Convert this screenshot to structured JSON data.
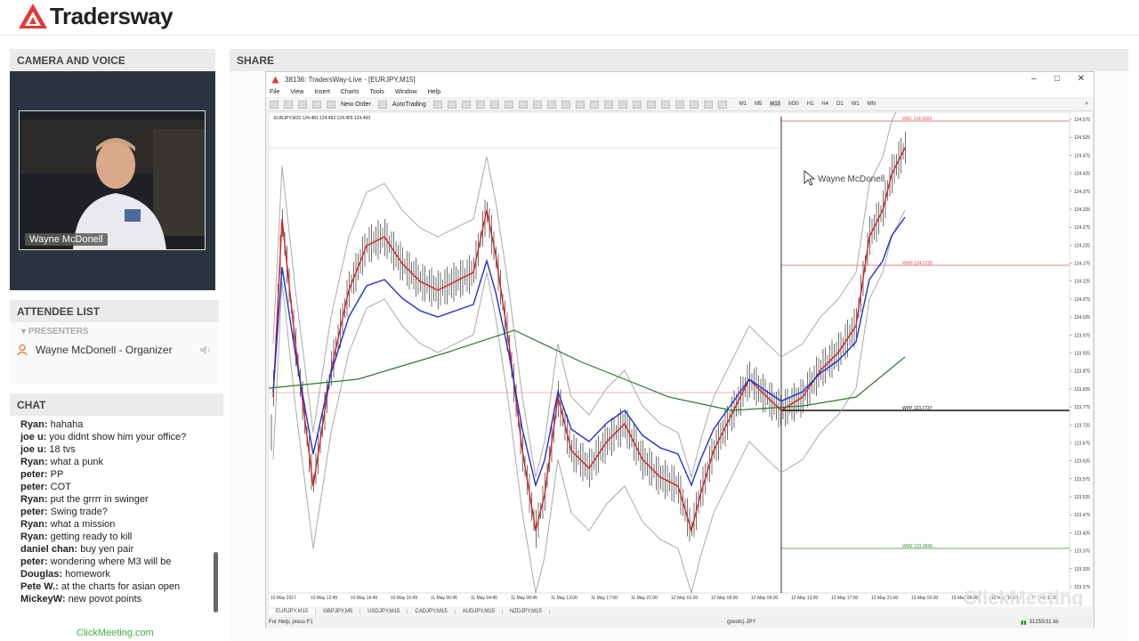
{
  "header": {
    "brand": "Tradersway"
  },
  "camera": {
    "heading": "CAMERA AND VOICE",
    "presenter_name": "Wayne McDonell"
  },
  "attendees": {
    "heading": "ATTENDEE LIST",
    "group_label": "PRESENTERS",
    "items": [
      {
        "name": "Wayne McDonell - Organizer"
      }
    ]
  },
  "chat": {
    "heading": "CHAT",
    "messages": [
      {
        "user": "Ryan:",
        "text": "hahaha"
      },
      {
        "user": "joe u:",
        "text": "you didnt show him your office?"
      },
      {
        "user": "joe u:",
        "text": "18 tvs"
      },
      {
        "user": "Ryan:",
        "text": "what a punk"
      },
      {
        "user": "peter:",
        "text": "PP"
      },
      {
        "user": "peter:",
        "text": "COT"
      },
      {
        "user": "Ryan:",
        "text": "put the grrrr in swinger"
      },
      {
        "user": "peter:",
        "text": "Swing trade?"
      },
      {
        "user": "Ryan:",
        "text": "what a mission"
      },
      {
        "user": "Ryan:",
        "text": "getting ready to kill"
      },
      {
        "user": "daniel chan:",
        "text": "buy yen pair"
      },
      {
        "user": "peter:",
        "text": "wondering where M3 will be"
      },
      {
        "user": "Douglas:",
        "text": "homework"
      },
      {
        "user": "Pete W.:",
        "text": "at the charts for asian open"
      },
      {
        "user": "MickeyW:",
        "text": "new povot points"
      }
    ]
  },
  "footer": {
    "link": "ClickMeeting.com"
  },
  "share": {
    "heading": "SHARE"
  },
  "mt4": {
    "title": "38136: TradersWay-Live - [EURJPY,M15]",
    "menu": [
      "File",
      "View",
      "Insert",
      "Charts",
      "Tools",
      "Window",
      "Help"
    ],
    "toolbar": {
      "new_order": "New Order",
      "auto_trading": "AutoTrading"
    },
    "timeframes": [
      "M1",
      "M5",
      "M15",
      "M30",
      "H1",
      "H4",
      "D1",
      "W1",
      "MN"
    ],
    "symbol_line": "EURJPY,M15  124.481 124.493 124.455 124.493",
    "pivot_labels": [
      "WR1 124.5693",
      "WM3 124.1735",
      "WPP 123.7737",
      "WM2 123.3840"
    ],
    "cursor_label": "Wayne McDonell",
    "price_ticks": [
      "124.575",
      "124.525",
      "124.475",
      "124.425",
      "124.375",
      "124.325",
      "124.275",
      "124.225",
      "124.175",
      "124.125",
      "124.075",
      "124.025",
      "123.975",
      "123.925",
      "123.875",
      "123.825",
      "123.775",
      "123.725",
      "123.675",
      "123.625",
      "123.575",
      "123.525",
      "123.475",
      "123.425",
      "123.375",
      "123.325",
      "123.275"
    ],
    "time_ticks": [
      "10 May 2017",
      "10 May 12:45",
      "10 May 16:45",
      "10 May 20:45",
      "11 May 00:45",
      "11 May 04:45",
      "11 May 08:45",
      "11 May 13:00",
      "11 May 17:00",
      "11 May 21:00",
      "12 May 01:00",
      "12 May 05:00",
      "12 May 09:00",
      "12 May 13:00",
      "12 May 17:00",
      "12 May 21:00",
      "15 May 02:00",
      "15 May 06:00",
      "15 May 10:00",
      "15 May 14:00"
    ],
    "tabs": [
      "EURJPY,M15",
      "GBPJPY,M5",
      "USDJPY,M15",
      "CADJPY,M15",
      "AUDJPY,M15",
      "NZDJPY,M15"
    ],
    "status_left": "For Help, press F1",
    "status_mid": "(pivots) JPY",
    "status_right": "31255/31 kb",
    "watermark": "ClickMeeting"
  }
}
